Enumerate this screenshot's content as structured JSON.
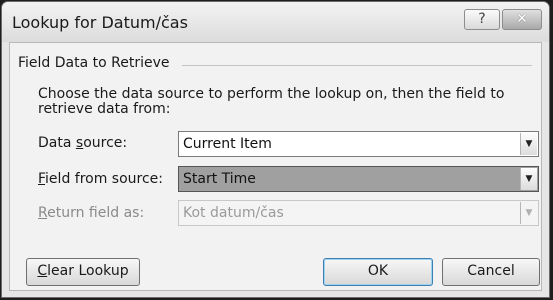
{
  "window": {
    "title": "Lookup for Datum/čas",
    "help_label": "?",
    "close_label": "✕"
  },
  "group": {
    "legend": "Field Data to Retrieve",
    "description": "Choose the data source to perform the lookup on, then the field to retrieve data from:"
  },
  "fields": {
    "data_source": {
      "label_pre": "Data ",
      "label_key": "s",
      "label_post": "ource:",
      "value": "Current Item"
    },
    "field_from_source": {
      "label_key": "F",
      "label_post": "ield from source:",
      "value": "Start Time"
    },
    "return_field_as": {
      "label_key": "R",
      "label_post": "eturn field as:",
      "value": "Kot datum/čas"
    }
  },
  "buttons": {
    "clear_key": "C",
    "clear_post": "lear Lookup",
    "ok": "OK",
    "cancel": "Cancel"
  }
}
